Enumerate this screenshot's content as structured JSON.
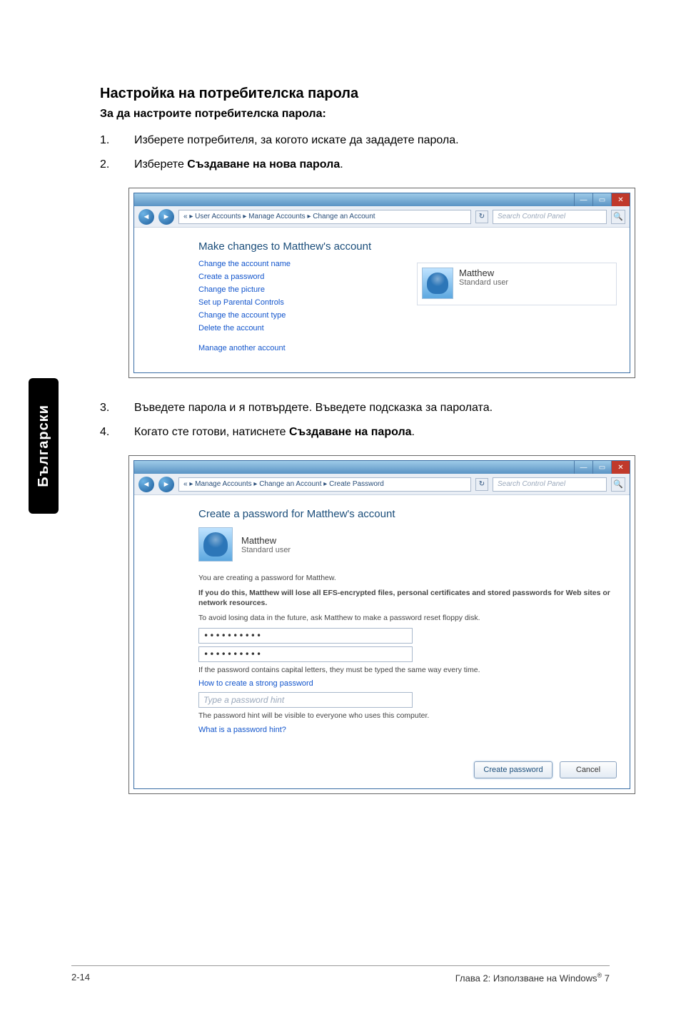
{
  "sideTab": "Български",
  "heading": "Настройка на потребителска парола",
  "subheading": "За да настроите потребителска парола:",
  "step1": {
    "n": "1.",
    "text": "Изберете потребителя, за когото искате да зададете парола."
  },
  "step2": {
    "n": "2.",
    "prefix": "Изберете ",
    "bold": "Създаване на нова парола",
    "suffix": "."
  },
  "step3": {
    "n": "3.",
    "text": "Въведете парола и я потвърдете. Въведете подсказка за паролата."
  },
  "step4": {
    "n": "4.",
    "prefix": "Когато сте готови, натиснете ",
    "bold": "Създаване на парола",
    "suffix": "."
  },
  "win1": {
    "navBack": "◄",
    "navFwd": "►",
    "breadcrumb": "« ▸ User Accounts ▸ Manage Accounts ▸ Change an Account",
    "refresh": "↻",
    "searchPlaceholder": "Search Control Panel",
    "searchIcon": "🔍",
    "heading": "Make changes to Matthew's account",
    "links": {
      "l1": "Change the account name",
      "l2": "Create a password",
      "l3": "Change the picture",
      "l4": "Set up Parental Controls",
      "l5": "Change the account type",
      "l6": "Delete the account",
      "l7": "Manage another account"
    },
    "user": {
      "name": "Matthew",
      "role": "Standard user"
    }
  },
  "win2": {
    "navBack": "◄",
    "navFwd": "►",
    "breadcrumb": "« ▸ Manage Accounts ▸ Change an Account ▸ Create Password",
    "refresh": "↻",
    "searchPlaceholder": "Search Control Panel",
    "searchIcon": "🔍",
    "heading": "Create a password for Matthew's account",
    "user": {
      "name": "Matthew",
      "role": "Standard user"
    },
    "line1": "You are creating a password for Matthew.",
    "line2": "If you do this, Matthew will lose all EFS-encrypted files, personal certificates and stored passwords for Web sites or network resources.",
    "line3": "To avoid losing data in the future, ask Matthew to make a password reset floppy disk.",
    "pass1": "••••••••••",
    "pass2": "••••••••••",
    "line4": "If the password contains capital letters, they must be typed the same way every time.",
    "link1": "How to create a strong password",
    "hintPlaceholder": "Type a password hint",
    "line5": "The password hint will be visible to everyone who uses this computer.",
    "link2": "What is a password hint?",
    "btnCreate": "Create password",
    "btnCancel": "Cancel"
  },
  "footer": {
    "left": "2-14",
    "rightPrefix": "Глава 2: Използване на Windows",
    "reg": "®",
    "rightSuffix": " 7"
  }
}
